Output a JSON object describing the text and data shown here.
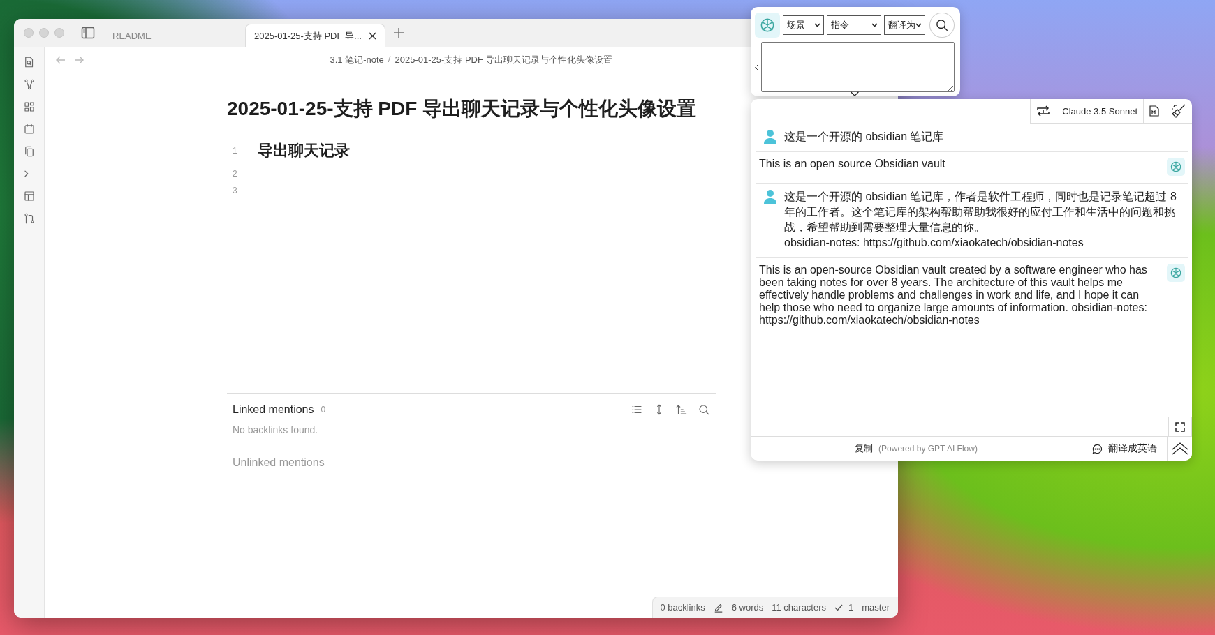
{
  "obsidian": {
    "tabs": [
      {
        "label": "README",
        "selected": false
      },
      {
        "label": "2025-01-25-支持 PDF 导...",
        "selected": true
      }
    ],
    "breadcrumb": [
      "3.1 笔记-note",
      "2025-01-25-支持 PDF 导出聊天记录与个性化头像设置"
    ],
    "breadcrumb_separator": "/",
    "title": "2025-01-25-支持 PDF 导出聊天记录与个性化头像设置",
    "lines": [
      {
        "number": "1",
        "kind": "heading",
        "text": "导出聊天记录"
      },
      {
        "number": "2",
        "kind": "blank"
      },
      {
        "number": "3",
        "kind": "blank"
      }
    ],
    "linked_mentions": {
      "title": "Linked mentions",
      "count": "0",
      "empty_text": "No backlinks found."
    },
    "unlinked_mentions": {
      "title": "Unlinked mentions"
    },
    "status_bar": {
      "backlinks": "0 backlinks",
      "words": "6 words",
      "characters": "11 characters",
      "sync": "1",
      "branch": "master"
    }
  },
  "translator": {
    "selects": [
      "场景",
      "指令",
      "翻译为"
    ]
  },
  "chat": {
    "model": "Claude 3.5 Sonnet",
    "messages": [
      {
        "kind": "user",
        "lines": [
          "这是一个开源的 obsidian 笔记库"
        ]
      },
      {
        "kind": "assistant",
        "lines": [
          "This is an open source Obsidian vault"
        ]
      },
      {
        "kind": "user",
        "lines": [
          "这是一个开源的 obsidian 笔记库，作者是软件工程师，同时也是记录笔记超过 8 年的工作者。这个笔记库的架构帮助帮助我很好的应付工作和生活中的问题和挑战，希望帮助到需要整理大量信息的你。",
          "obsidian-notes: https://github.com/xiaokatech/obsidian-notes"
        ]
      },
      {
        "kind": "assistant",
        "lines": [
          "This is an open-source Obsidian vault created by a software engineer who has been taking notes for over 8 years. The architecture of this vault helps me effectively handle problems and challenges in work and life, and I hope it can help those who need to organize large amounts of information. obsidian-notes: https://github.com/xiaokatech/obsidian-notes"
        ]
      }
    ],
    "copy_label": "复制",
    "powered_by": "(Powered by GPT AI Flow)",
    "translate_button": "翻译成英语"
  }
}
